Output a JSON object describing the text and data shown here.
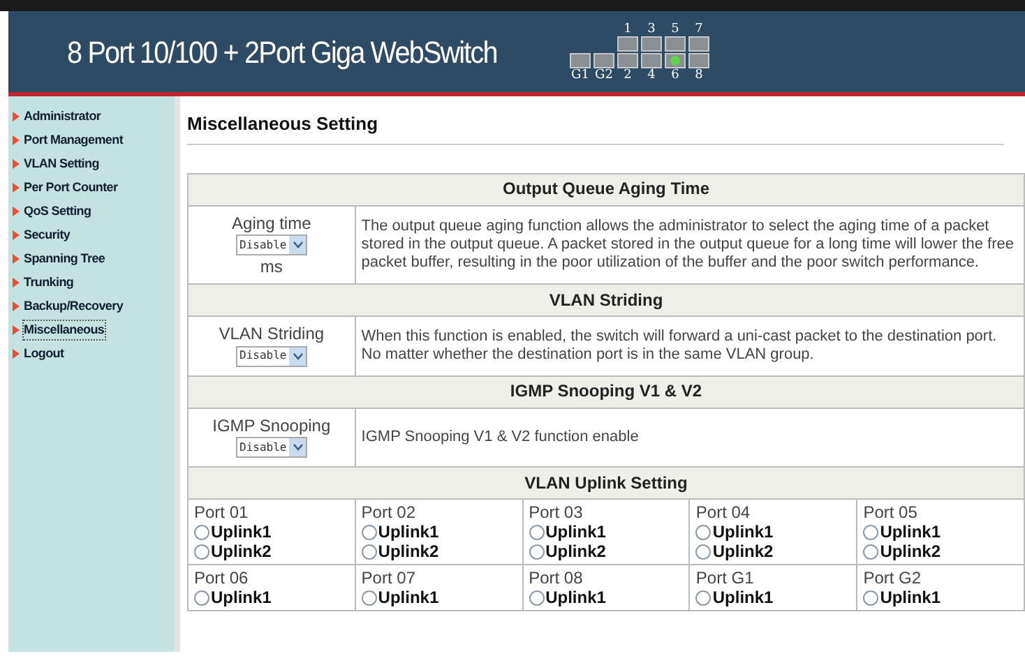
{
  "header": {
    "title": "8 Port 10/100 + 2Port Giga WebSwitch",
    "ports_top": [
      {
        "label": "1",
        "lit": false
      },
      {
        "label": "3",
        "lit": false
      },
      {
        "label": "5",
        "lit": false
      },
      {
        "label": "7",
        "lit": false
      }
    ],
    "ports_bottom": [
      {
        "label": "G1",
        "lit": false
      },
      {
        "label": "G2",
        "lit": false
      },
      {
        "label": "2",
        "lit": false
      },
      {
        "label": "4",
        "lit": false
      },
      {
        "label": "6",
        "lit": true
      },
      {
        "label": "8",
        "lit": false
      }
    ]
  },
  "sidebar": {
    "items": [
      {
        "label": "Administrator",
        "selected": false
      },
      {
        "label": "Port Management",
        "selected": false
      },
      {
        "label": "VLAN Setting",
        "selected": false
      },
      {
        "label": "Per Port Counter",
        "selected": false
      },
      {
        "label": "QoS Setting",
        "selected": false
      },
      {
        "label": "Security",
        "selected": false
      },
      {
        "label": "Spanning Tree",
        "selected": false
      },
      {
        "label": "Trunking",
        "selected": false
      },
      {
        "label": "Backup/Recovery",
        "selected": false
      },
      {
        "label": "Miscellaneous",
        "selected": true
      },
      {
        "label": "Logout",
        "selected": false
      }
    ]
  },
  "page_title": "Miscellaneous Setting",
  "sections": [
    {
      "heading": "Output Queue Aging Time",
      "label": "Aging time",
      "select": "Disable",
      "unit": "ms",
      "description": "The output queue aging function allows the administrator to select the aging time of a packet stored in the output queue. A packet stored in the output queue for a long time will lower the free packet buffer, resulting in the poor utilization of the buffer and the poor switch performance."
    },
    {
      "heading": "VLAN Striding",
      "label": "VLAN Striding",
      "select": "Disable",
      "description": "When this function is enabled, the switch will forward a uni-cast packet to the destination port. No matter whether the destination port is in the same VLAN group."
    },
    {
      "heading": "IGMP Snooping V1 & V2",
      "label": "IGMP Snooping",
      "select": "Disable",
      "description": "IGMP Snooping V1 & V2 function enable"
    }
  ],
  "uplink": {
    "heading": "VLAN Uplink Setting",
    "ports": [
      {
        "label": "Port 01",
        "options": [
          {
            "label": "Uplink1",
            "selected": false
          },
          {
            "label": "Uplink2",
            "selected": false
          }
        ]
      },
      {
        "label": "Port 02",
        "options": [
          {
            "label": "Uplink1",
            "selected": false
          },
          {
            "label": "Uplink2",
            "selected": false
          }
        ]
      },
      {
        "label": "Port 03",
        "options": [
          {
            "label": "Uplink1",
            "selected": false
          },
          {
            "label": "Uplink2",
            "selected": false
          }
        ]
      },
      {
        "label": "Port 04",
        "options": [
          {
            "label": "Uplink1",
            "selected": false
          },
          {
            "label": "Uplink2",
            "selected": false
          }
        ]
      },
      {
        "label": "Port 05",
        "options": [
          {
            "label": "Uplink1",
            "selected": false
          },
          {
            "label": "Uplink2",
            "selected": false
          }
        ]
      },
      {
        "label": "Port 06",
        "options": [
          {
            "label": "Uplink1",
            "selected": false
          }
        ]
      },
      {
        "label": "Port 07",
        "options": [
          {
            "label": "Uplink1",
            "selected": false
          }
        ]
      },
      {
        "label": "Port 08",
        "options": [
          {
            "label": "Uplink1",
            "selected": false
          }
        ]
      },
      {
        "label": "Port G1",
        "options": [
          {
            "label": "Uplink1",
            "selected": false
          }
        ]
      },
      {
        "label": "Port G2",
        "options": [
          {
            "label": "Uplink1",
            "selected": false
          }
        ]
      }
    ]
  }
}
